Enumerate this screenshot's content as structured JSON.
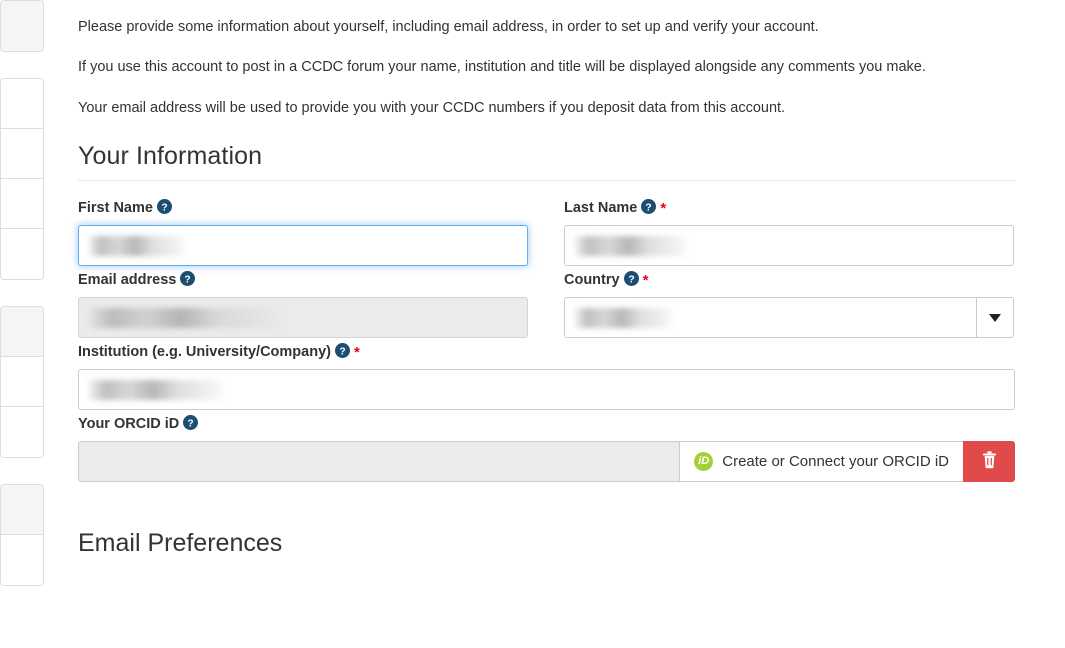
{
  "sidebar": {
    "groups": [
      {
        "items": [
          {
            "state": "active"
          }
        ]
      },
      {
        "items": [
          {
            "state": "default"
          },
          {
            "state": "default"
          },
          {
            "state": "default"
          },
          {
            "state": "default"
          }
        ]
      },
      {
        "items": [
          {
            "state": "active"
          },
          {
            "state": "default"
          },
          {
            "state": "default"
          }
        ]
      },
      {
        "items": [
          {
            "state": "active"
          },
          {
            "state": "default"
          }
        ]
      }
    ]
  },
  "intro": {
    "paragraph1": "Please provide some information about yourself, including email address, in order to set up and verify your account.",
    "paragraph2": "If you use this account to post in a CCDC forum your name, institution and title will be displayed alongside any comments you make.",
    "paragraph3": "Your email address will be used to provide you with your CCDC numbers if you deposit data from this account."
  },
  "sections": {
    "your_information": "Your Information",
    "email_preferences": "Email Preferences"
  },
  "form": {
    "first_name": {
      "label": "First Name",
      "help_icon": "help-circle-icon",
      "required": false,
      "value": "",
      "redacted": true,
      "state": "focused",
      "disabled": false
    },
    "last_name": {
      "label": "Last Name",
      "help_icon": "help-circle-icon",
      "required": true,
      "required_marker": "*",
      "value": "",
      "redacted": true,
      "state": "default",
      "disabled": false
    },
    "email_address": {
      "label": "Email address",
      "help_icon": "help-circle-icon",
      "required": false,
      "value": "",
      "redacted": true,
      "state": "default",
      "disabled": true
    },
    "country": {
      "label": "Country",
      "help_icon": "help-circle-icon",
      "required": true,
      "required_marker": "*",
      "value": "",
      "redacted": true,
      "control": "select",
      "caret_icon": "chevron-down-icon",
      "state": "default",
      "disabled": false
    },
    "institution": {
      "label": "Institution (e.g. University/Company)",
      "help_icon": "help-circle-icon",
      "required": true,
      "required_marker": "*",
      "value": "",
      "redacted": true,
      "state": "default",
      "disabled": false
    },
    "orcid": {
      "label": "Your ORCID iD",
      "help_icon": "help-circle-icon",
      "required": false,
      "value": "",
      "disabled": true,
      "connect_button_label": "Create or Connect your ORCID iD",
      "connect_button_icon": "orcid-id-icon",
      "connect_button_icon_text": "iD",
      "delete_button_icon": "trash-icon"
    }
  },
  "colors": {
    "help_icon": "#1b4f72",
    "required_star": "#e8001c",
    "focus_border": "#66afe9",
    "orcid_green": "#a6ce39",
    "delete_red": "#e04a4a",
    "disabled_bg": "#ebebeb",
    "border": "#cccccc"
  }
}
